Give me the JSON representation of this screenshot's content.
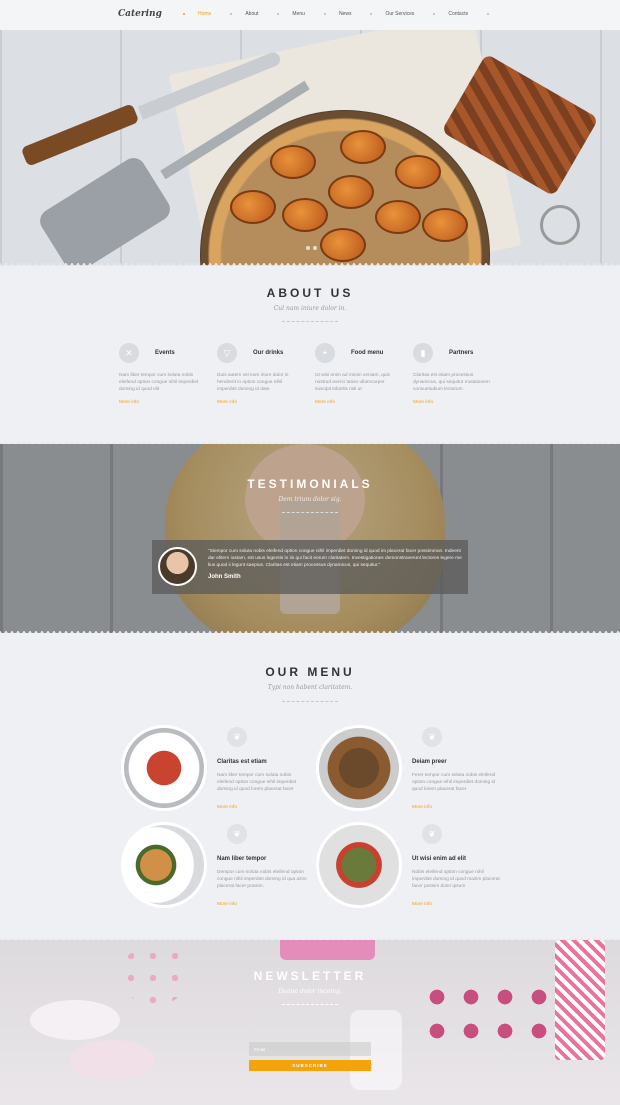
{
  "nav": {
    "logo": "Catering",
    "items": [
      {
        "label": "Home"
      },
      {
        "label": "About"
      },
      {
        "label": "Menu"
      },
      {
        "label": "News"
      },
      {
        "label": "Our Services"
      },
      {
        "label": "Contacts"
      }
    ]
  },
  "about": {
    "title": "ABOUT US",
    "subtitle": "Cul nam iniure dolor in.",
    "features": [
      {
        "title": "Events",
        "icon": "fork-knife-icon",
        "text": "Nam liber tempor cum soluta nobis eleifend option congue nihil imperdiet doming id quod elit",
        "more": "More info"
      },
      {
        "title": "Our drinks",
        "icon": "cocktail-icon",
        "text": "Duis autem vel eum iriure dolor in hendrerit in option congue nihil imperdiet doming id date",
        "more": "More info"
      },
      {
        "title": "Food menu",
        "icon": "cloche-icon",
        "text": "Ut wisi enim ad minim veniam, quis nostrud exerci tation ullamcorper suscipit lobortis nisl ut",
        "more": "More info"
      },
      {
        "title": "Partners",
        "icon": "bottle-icon",
        "text": "Claritas est etiam processus dynamicus, qui sequitur mutationem consuetudium lectorum",
        "more": "More info"
      }
    ]
  },
  "testimonials": {
    "title": "TESTIMONIALS",
    "subtitle": "Dem trium dolor sig.",
    "quote": "\"Siempor cum soluta nobis eleifend option congue nihil imperdiet doming id quod im placerat facer possimmon. Indeent dar elitern iustam, est usus legentis in iis qui facit eorum claritatem. Investigationes demonstraverunt lectores legere me lius quod ii legunt saepius. Claritas est etiam processus dynamicus, qui sequitur.\"",
    "author": "John Smith"
  },
  "menu": {
    "title": "OUR MENU",
    "subtitle": "Typi non habent claritatem.",
    "dishes": [
      {
        "title": "Claritas est etiam",
        "text": "Nam liber tempor cum soluta nobis eleifend option congue nihil imperdiet doming id quod lorem placerat facer",
        "more": "More info"
      },
      {
        "title": "Deiam preer",
        "text": "Ferer tempor cum soluta nobis eleifend option congue nihil imperdiet doming id quod lorem placerat facer",
        "more": "More info"
      },
      {
        "title": "Nam liber tempor",
        "text": "Dempor cum soluta nobis eleifend option congue nihil imperdiet doming id qua azim placerat facer possim.",
        "more": "More info"
      },
      {
        "title": "Ut wisi enim ad elit",
        "text": "Nobis eleifend option congue nihil imperdiet doming id quod mazim placerat facer possim dolor ipsum",
        "more": "More info"
      }
    ]
  },
  "newsletter": {
    "title": "NEWSLETTER",
    "subtitle": "Duane dolor incomg.",
    "email_placeholder": "Email",
    "button": "SUBSCRIBE"
  },
  "colors": {
    "accent": "#f0a020",
    "button": "#f5a30a"
  }
}
